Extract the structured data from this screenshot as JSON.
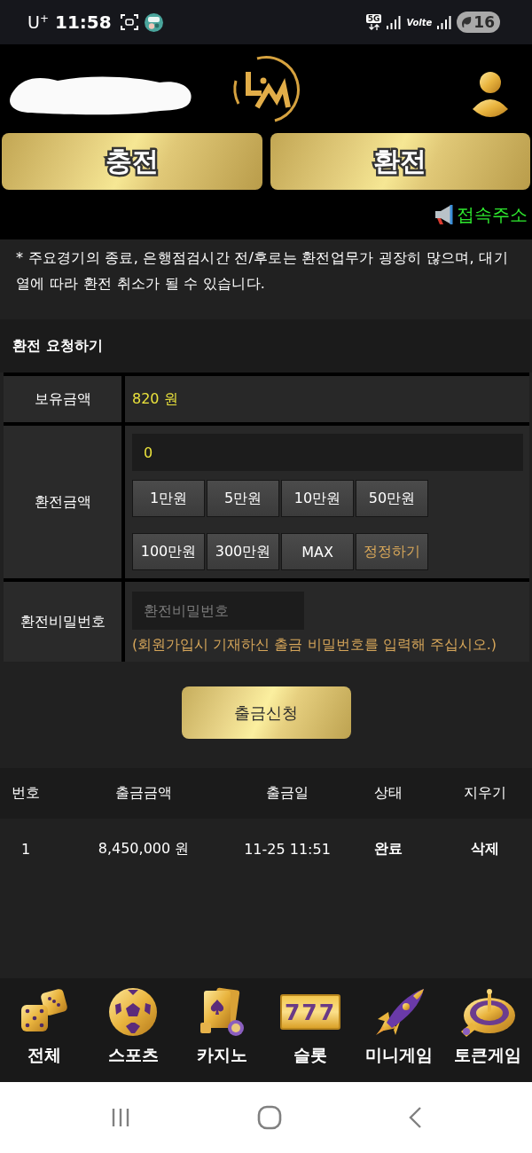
{
  "status_bar": {
    "carrier": "U$^{+}$",
    "time": "11:58",
    "network": "5G",
    "call": "Volte",
    "battery": "16"
  },
  "header": {
    "buttons": [
      {
        "label": "충전"
      },
      {
        "label": "환전"
      }
    ],
    "ticker": "접속주소"
  },
  "notice": "* 주요경기의 종료, 은행점검시간 전/후로는 환전업무가 굉장히 많으며, 대기열에 따라 환전 취소가 될 수 있습니다.",
  "request_form": {
    "title": "환전 요청하기",
    "rows": [
      {
        "kind": "balance",
        "label": "보유금액",
        "value": "820 원"
      },
      {
        "kind": "amount",
        "label": "환전금액",
        "value": "0",
        "quick_buttons": [
          {
            "kind": "add",
            "label": "1만원"
          },
          {
            "kind": "add",
            "label": "5만원"
          },
          {
            "kind": "add",
            "label": "10만원"
          },
          {
            "kind": "add",
            "label": "50만원"
          },
          {
            "kind": "add",
            "label": "100만원"
          },
          {
            "kind": "add",
            "label": "300만원"
          },
          {
            "kind": "add",
            "label": "MAX"
          },
          {
            "kind": "reset",
            "label": "정정하기"
          }
        ]
      },
      {
        "kind": "password",
        "label": "환전비밀번호",
        "placeholder": "환전비밀번호",
        "hint": "(회원가입시 기재하신 출금 비밀번호를 입력해 주십시오.)"
      }
    ],
    "submit": "출금신청"
  },
  "history": {
    "columns": [
      "번호",
      "출금금액",
      "출금일",
      "상태",
      "지우기"
    ],
    "rows": [
      {
        "number": "1",
        "amount": "8,450,000 원",
        "date": "11-25 11:51",
        "status": "완료",
        "action": "삭제"
      }
    ]
  },
  "bottom_nav": [
    {
      "kind": "dice",
      "label": "전체"
    },
    {
      "kind": "ball",
      "label": "스포츠"
    },
    {
      "kind": "cards",
      "label": "카지노"
    },
    {
      "kind": "slot",
      "label": "슬롯",
      "icon_text": "777"
    },
    {
      "kind": "rocket",
      "label": "미니게임"
    },
    {
      "kind": "roulette",
      "label": "토큰게임"
    }
  ]
}
